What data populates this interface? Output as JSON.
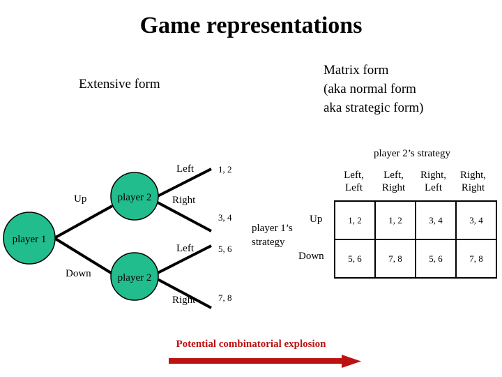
{
  "slide": {
    "title": "Game representations",
    "extensive_form_label": "Extensive form",
    "matrix_form_label": "Matrix form\n(aka normal form\naka strategic form)"
  },
  "colors": {
    "node_fill": "#22bd8c",
    "node_stroke": "#000000",
    "edge": "#000000",
    "accent_red": "#bc1212",
    "text": "#000000"
  },
  "tree": {
    "root": {
      "label": "player 1"
    },
    "nodes": [
      {
        "label": "player 2"
      },
      {
        "label": "player 2"
      }
    ],
    "root_edges": [
      {
        "label": "Up"
      },
      {
        "label": "Down"
      }
    ],
    "leaf_edges": [
      {
        "label": "Left",
        "payoff": "1, 2"
      },
      {
        "label": "Right",
        "payoff": "3, 4"
      },
      {
        "label": "Left",
        "payoff": "5, 6"
      },
      {
        "label": "Right",
        "payoff": "7, 8"
      }
    ]
  },
  "matrix": {
    "col_group_label": "player 2’s strategy",
    "row_group_label": "player 1’s\nstrategy",
    "columns": [
      "Left,\nLeft",
      "Left,\nRight",
      "Right,\nLeft",
      "Right,\nRight"
    ],
    "rows": [
      {
        "label": "Up",
        "cells": [
          "1, 2",
          "1, 2",
          "3, 4",
          "3, 4"
        ]
      },
      {
        "label": "Down",
        "cells": [
          "5, 6",
          "7, 8",
          "5, 6",
          "7, 8"
        ]
      }
    ]
  },
  "callout": {
    "text": "Potential combinatorial explosion",
    "arrow_direction": "right"
  }
}
